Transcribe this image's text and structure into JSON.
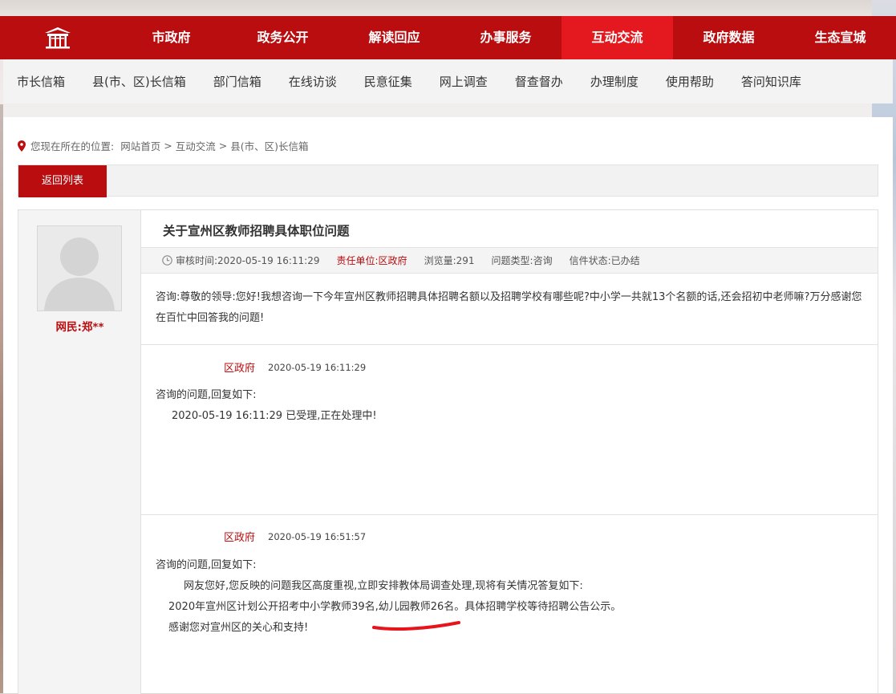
{
  "nav": {
    "items": [
      "市政府",
      "政务公开",
      "解读回应",
      "办事服务",
      "互动交流",
      "政府数据",
      "生态宣城"
    ],
    "active_index": 4,
    "logo_icon": "pavilion-logo-icon"
  },
  "subnav": {
    "items": [
      "市长信箱",
      "县(市、区)长信箱",
      "部门信箱",
      "在线访谈",
      "民意征集",
      "网上调查",
      "督查督办",
      "办理制度",
      "使用帮助",
      "答问知识库"
    ]
  },
  "breadcrumb": {
    "prefix": "您现在所在的位置:",
    "items": [
      "网站首页",
      "互动交流",
      "县(市、区)长信箱"
    ],
    "separator": ">",
    "icon": "location-pin-icon"
  },
  "back_button": "返回列表",
  "sender": {
    "label": "网民:郑**"
  },
  "letter": {
    "title": "关于宣州区教师招聘具体职位问题",
    "meta": {
      "review_time_label": "审核时间:",
      "review_time": "2020-05-19 16:11:29",
      "unit_label": "责任单位:",
      "unit": "区政府",
      "views_label": "浏览量:",
      "views": "291",
      "type_label": "问题类型:",
      "type": "咨询",
      "status_label": "信件状态:",
      "status": "已办结"
    },
    "question": "咨询:尊敬的领导:您好!我想咨询一下今年宣州区教师招聘具体招聘名额以及招聘学校有哪些呢?中小学一共就13个名额的话,还会招初中老师嘛?万分感谢您在百忙中回答我的问题!"
  },
  "replies": [
    {
      "org": "区政府",
      "time": "2020-05-19 16:11:29",
      "lines": [
        "咨询的问题,回复如下:",
        "2020-05-19 16:11:29 已受理,正在处理中!"
      ]
    },
    {
      "org": "区政府",
      "time": "2020-05-19 16:51:57",
      "lines": [
        "咨询的问题,回复如下:",
        "网友您好,您反映的问题我区高度重视,立即安排教体局调查处理,现将有关情况答复如下:",
        "2020年宣州区计划公开招考中小学教师39名,幼儿园教师26名。具体招聘学校等待招聘公告公示。",
        "感谢您对宣州区的关心和支持!"
      ]
    }
  ],
  "colors": {
    "brand_red": "#b90d10",
    "active_red": "#e3191f",
    "annotation_red": "#e8141b"
  }
}
